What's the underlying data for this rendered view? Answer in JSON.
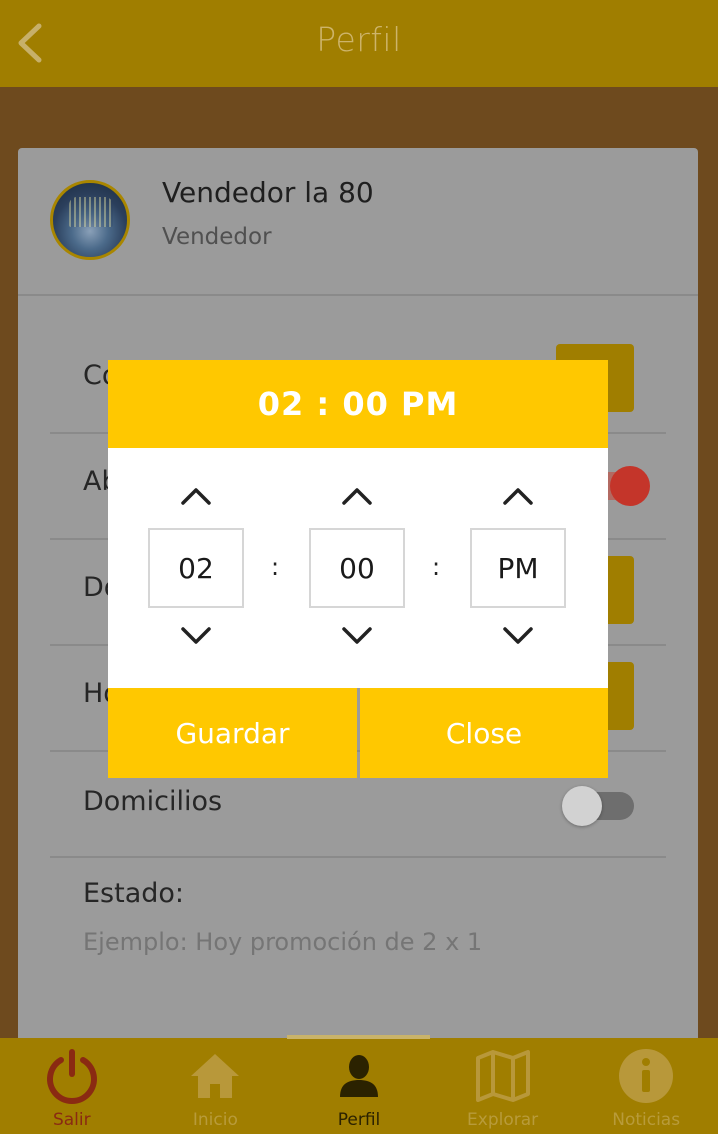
{
  "header": {
    "title": "Perfil",
    "back_icon": "chevron-left-icon"
  },
  "profile": {
    "name": "Vendedor la 80",
    "role": "Vendedor"
  },
  "rows": [
    {
      "label": "Co"
    },
    {
      "label": "Ab"
    },
    {
      "label": "Do"
    },
    {
      "label": "Ho"
    },
    {
      "label": "Domicilios"
    }
  ],
  "estado": {
    "label": "Estado:",
    "placeholder": "Ejemplo: Hoy promoción de 2 x 1"
  },
  "time_picker": {
    "display": "02 : 00 PM",
    "hour": "02",
    "minute": "00",
    "period": "PM",
    "separator": ":",
    "save_label": "Guardar",
    "close_label": "Close"
  },
  "nav": {
    "items": [
      {
        "label": "Salir",
        "icon": "power-icon"
      },
      {
        "label": "Inicio",
        "icon": "home-icon"
      },
      {
        "label": "Perfil",
        "icon": "user-icon"
      },
      {
        "label": "Explorar",
        "icon": "map-icon"
      },
      {
        "label": "Noticias",
        "icon": "info-icon"
      }
    ],
    "active": "Perfil"
  },
  "colors": {
    "accent": "#ffc800",
    "header": "#a07e00",
    "toggle_on": "#d03a2b"
  }
}
